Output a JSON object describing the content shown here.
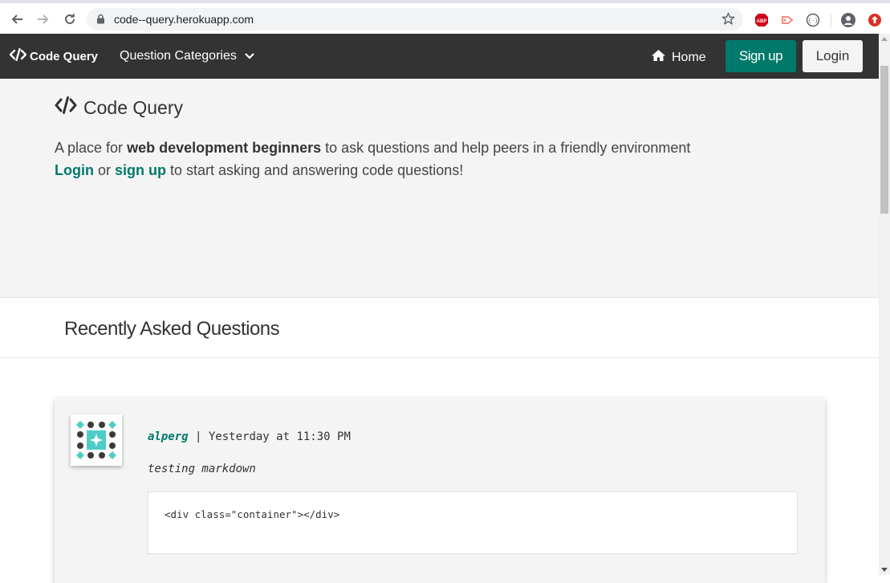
{
  "browser": {
    "url": "code--query.herokuapp.com",
    "extensions": [
      "adblock-plus-icon",
      "cast-extension-icon",
      "dev-tools-icon"
    ]
  },
  "navbar": {
    "brand": "Code Query",
    "categories_label": "Question Categories",
    "home_label": "Home",
    "signup_label": "Sign up",
    "login_label": "Login"
  },
  "hero": {
    "title": "Code Query",
    "line1_prefix": "A place for ",
    "line1_bold": "web development beginners",
    "line1_suffix": " to ask questions and help peers in a friendly environment",
    "line2_login": "Login",
    "line2_or": " or ",
    "line2_signup": "sign up",
    "line2_suffix": " to start asking and answering code questions!"
  },
  "recent": {
    "title": "Recently Asked Questions",
    "questions": [
      {
        "user": "alperg",
        "separator": " | ",
        "time": "Yesterday at 11:30 PM",
        "title": "testing markdown",
        "code": "<div class=\"container\"></div>"
      }
    ]
  },
  "colors": {
    "brand_green": "#00796b",
    "navbar_bg": "#333333",
    "hero_bg": "#f4f4f4"
  }
}
